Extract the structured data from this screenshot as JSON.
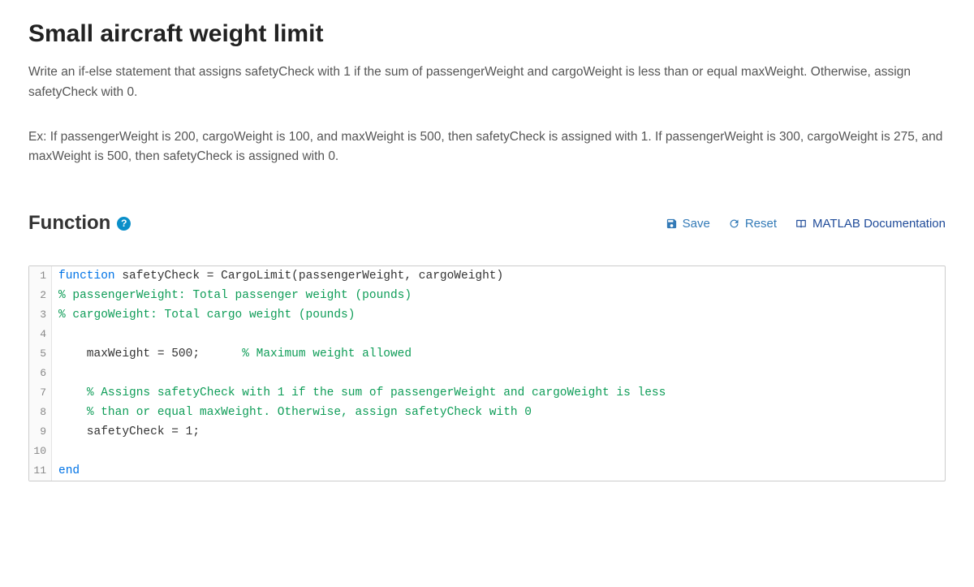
{
  "title": "Small aircraft weight limit",
  "description1": "Write an if-else statement that assigns safetyCheck with 1 if the sum of passengerWeight and cargoWeight is less than or equal maxWeight. Otherwise, assign safetyCheck with 0.",
  "description2": "Ex: If passengerWeight is 200, cargoWeight is 100, and maxWeight is 500, then safetyCheck is assigned with 1. If passengerWeight is 300, cargoWeight is 275, and maxWeight is 500, then safetyCheck is assigned with 0.",
  "section_label": "Function",
  "help_symbol": "?",
  "toolbar": {
    "save": "Save",
    "reset": "Reset",
    "docs": "MATLAB Documentation"
  },
  "code": {
    "lines": [
      {
        "n": "1",
        "tokens": [
          {
            "t": "function ",
            "c": "kw"
          },
          {
            "t": "safetyCheck = CargoLimit(passengerWeight, cargoWeight)",
            "c": ""
          }
        ]
      },
      {
        "n": "2",
        "tokens": [
          {
            "t": "% passengerWeight: Total passenger weight (pounds)",
            "c": "comment"
          }
        ]
      },
      {
        "n": "3",
        "tokens": [
          {
            "t": "% cargoWeight: Total cargo weight (pounds)",
            "c": "comment"
          }
        ]
      },
      {
        "n": "4",
        "tokens": [
          {
            "t": "",
            "c": ""
          }
        ]
      },
      {
        "n": "5",
        "tokens": [
          {
            "t": "    maxWeight = 500;      ",
            "c": ""
          },
          {
            "t": "% Maximum weight allowed",
            "c": "comment"
          }
        ]
      },
      {
        "n": "6",
        "tokens": [
          {
            "t": "",
            "c": ""
          }
        ]
      },
      {
        "n": "7",
        "tokens": [
          {
            "t": "    ",
            "c": ""
          },
          {
            "t": "% Assigns safetyCheck with 1 if the sum of passengerWeight and cargoWeight is less",
            "c": "comment"
          }
        ]
      },
      {
        "n": "8",
        "tokens": [
          {
            "t": "    ",
            "c": ""
          },
          {
            "t": "% than or equal maxWeight. Otherwise, assign safetyCheck with 0",
            "c": "comment"
          }
        ]
      },
      {
        "n": "9",
        "tokens": [
          {
            "t": "    safetyCheck = 1;",
            "c": ""
          }
        ]
      },
      {
        "n": "10",
        "tokens": [
          {
            "t": "",
            "c": ""
          }
        ]
      },
      {
        "n": "11",
        "tokens": [
          {
            "t": "end",
            "c": "kw"
          }
        ]
      }
    ]
  }
}
